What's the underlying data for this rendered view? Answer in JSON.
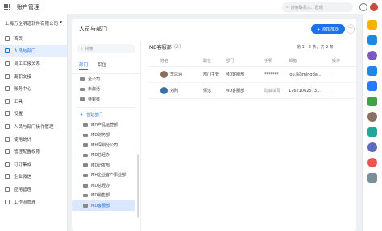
{
  "window": {
    "title": "账户管理"
  },
  "search": {
    "placeholder": "搜索联系人、群组"
  },
  "sidebar": {
    "company": "上海万企明道软件有限公司",
    "items": [
      {
        "label": "首页"
      },
      {
        "label": "人员与部门"
      },
      {
        "label": "员工汇报关系"
      },
      {
        "label": "离职交接"
      },
      {
        "label": "账务中心"
      },
      {
        "label": "工具"
      },
      {
        "label": "设置"
      },
      {
        "label": "人员与部门操作管理"
      },
      {
        "label": "使用统计"
      },
      {
        "label": "管理配置权限"
      },
      {
        "label": "钉钉集成"
      },
      {
        "label": "企业微信"
      },
      {
        "label": "应用管理"
      },
      {
        "label": "工作流管理"
      }
    ]
  },
  "main": {
    "title": "人员与部门",
    "add_button": "+ 添加成员",
    "more_button": "···",
    "tree": {
      "search_placeholder": "搜索",
      "tabs": [
        "部门",
        "职位"
      ],
      "top_items": [
        "全公司",
        "未激活",
        "待审核"
      ],
      "create_dept": "创建部门",
      "departments": [
        "MD产品运营部",
        "MD财务部",
        "MH深圳分公司",
        "MD总经办",
        "MD研发部",
        "MH企业客户事业部",
        "MD总经办",
        "MD销售部",
        "MD客服部"
      ]
    },
    "content": {
      "dept_name": "MD客服部",
      "count": "(2)",
      "pager": "第 1 - 2 条，共 2 条",
      "columns": [
        "姓名",
        "职位",
        "部门",
        "手机",
        "邮箱",
        "操作"
      ],
      "rows": [
        {
          "name": "李思涵",
          "title": "部门主管",
          "dept": "MD客服部",
          "phone": "*******",
          "email": "lou.li@mingda..."
        },
        {
          "name": "刘刚",
          "title": "保洁",
          "dept": "MD客服部",
          "phone": "隐藏填写",
          "email": "17621062573..."
        }
      ]
    }
  },
  "colors": {
    "accent": "#1a73e8",
    "active_bg": "#e6efff"
  }
}
